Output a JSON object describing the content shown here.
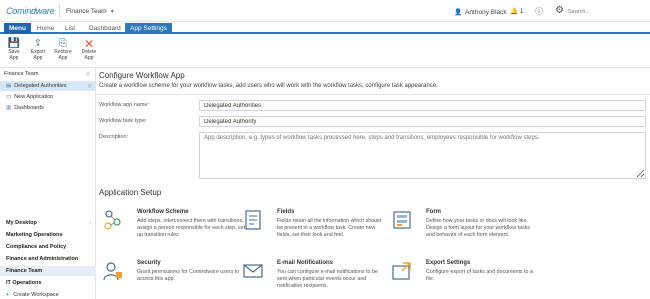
{
  "header": {
    "logo": "Comindware",
    "workspace": "Finance Team",
    "user": "Anthony Black",
    "notifications": "1",
    "search_placeholder": "Search..."
  },
  "tabs": [
    "Menu",
    "Home",
    "List",
    "Dashboard",
    "App Settings"
  ],
  "ribbon": {
    "save": "Save App",
    "export": "Export App",
    "restore": "Restore App",
    "delete": "Delete App"
  },
  "sidebar": {
    "header": "Finance Team",
    "items": [
      "Delegated Authorities",
      "New Application",
      "Dashboards"
    ],
    "workspaces": [
      "My Desktop",
      "Marketing Operations",
      "Compliance and Policy",
      "Finance and Administration",
      "Finance Team",
      "IT Operations"
    ],
    "create": "Create Workspace"
  },
  "main": {
    "title": "Configure Workflow App",
    "description": "Create a workflow scheme for your workflow tasks, add users who will work with the workflow tasks, configure task appearance.",
    "app_name_label": "Workflow app name:",
    "app_name_value": "Delegated Authorities",
    "task_type_label": "Workflow task type:",
    "task_type_value": "Delegated Authority",
    "description_label": "Description:",
    "description_placeholder": "App description, e.g. types of workflow tasks processed here, steps and transitions, employees responsible for workflow steps."
  },
  "setup": {
    "title": "Application Setup",
    "cards": [
      {
        "title": "Workflow Scheme",
        "text": "Add steps, interconnect them with transitions, assign a person responsible for each step, set up transition rules",
        "icon": "workflow-icon"
      },
      {
        "title": "Fields",
        "text": "Fields retain all the information which should be present in a workflow task. Create new fields, set their look and feel.",
        "icon": "fields-icon"
      },
      {
        "title": "Form",
        "text": "Define how your tasks or docs will look like. Design a form layout for your workflow tasks and behavior of each form element.",
        "icon": "form-icon"
      },
      {
        "title": "Security",
        "text": "Grant permissions for Comindware users to access this app.",
        "icon": "security-icon"
      },
      {
        "title": "E-mail Notifications",
        "text": "You can configure e-mail notifications to be sent when particular events occur and notification recipients.",
        "icon": "email-icon"
      },
      {
        "title": "Export Settings",
        "text": "Configure export of tasks and documents to a file.",
        "icon": "export-icon"
      }
    ]
  },
  "colors": {
    "accent": "#2e77b8",
    "menu": "#1e66b1",
    "active_item": "#d7e7f6",
    "delete": "#e05a3a"
  }
}
